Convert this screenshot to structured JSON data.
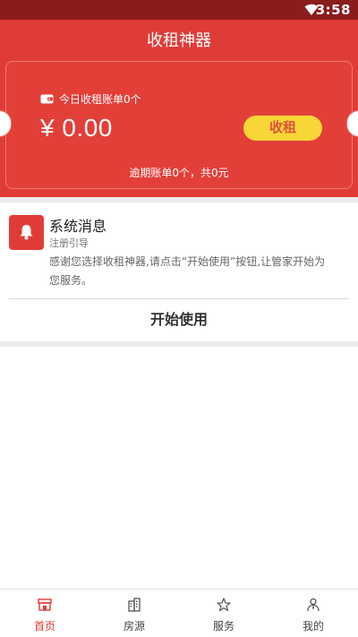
{
  "status_bar": {
    "time": "3:58"
  },
  "header": {
    "title": "收租神器"
  },
  "ticket": {
    "today_label": "今日收租账单0个",
    "amount": "¥ 0.00",
    "collect_button": "收租",
    "overdue": "逾期账单0个，共0元"
  },
  "message": {
    "title": "系统消息",
    "subtitle": "注册引导",
    "body": "感谢您选择收租神器,请点击“开始使用”按钮,让管家开始为您服务。",
    "start_button": "开始使用"
  },
  "tabs": [
    {
      "label": "首页",
      "icon": "store-icon",
      "active": true
    },
    {
      "label": "房源",
      "icon": "building-icon",
      "active": false
    },
    {
      "label": "服务",
      "icon": "star-icon",
      "active": false
    },
    {
      "label": "我的",
      "icon": "person-icon",
      "active": false
    }
  ],
  "colors": {
    "primary": "#e03c37",
    "button_yellow": "#f8d637",
    "status_bar": "#8a1c1c"
  }
}
